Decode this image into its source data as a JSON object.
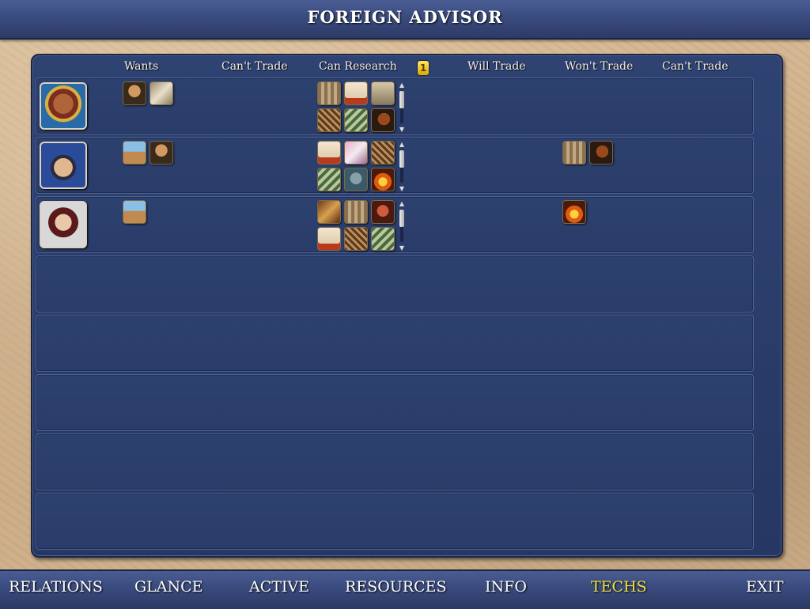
{
  "window": {
    "title": "FOREIGN ADVISOR"
  },
  "columns": {
    "wants": "Wants",
    "cant_trade_left": "Can't Trade",
    "can_research": "Can Research",
    "gold_icon": "gold-icon",
    "will_trade": "Will Trade",
    "wont_trade": "Won't Trade",
    "cant_trade_right": "Can't Trade"
  },
  "civs": [
    {
      "leader_icon": "aztec-leader-portrait",
      "wants": [
        "philosophy-tech-icon",
        "writing-tech-icon"
      ],
      "can_research": [
        "code-of-laws-tech-icon",
        "literacy-tech-icon",
        "mythology-tech-icon",
        "mathematics-tech-icon",
        "currency-tech-icon",
        "horseback-riding-tech-icon"
      ],
      "wont_trade": []
    },
    {
      "leader_icon": "mongol-leader-portrait",
      "wants": [
        "masonry-tech-icon",
        "philosophy-tech-icon"
      ],
      "can_research": [
        "literacy-tech-icon",
        "philosophy-tech-icon",
        "mathematics-tech-icon",
        "currency-tech-icon",
        "monotheism-tech-icon",
        "bronze-working-tech-icon"
      ],
      "wont_trade": [
        "code-of-laws-tech-icon",
        "horseback-riding-tech-icon"
      ]
    },
    {
      "leader_icon": "european-leader-portrait",
      "wants": [
        "masonry-tech-icon"
      ],
      "can_research": [
        "writing-tech-icon",
        "code-of-laws-tech-icon",
        "warrior-code-tech-icon",
        "literacy-tech-icon",
        "mathematics-tech-icon",
        "currency-tech-icon"
      ],
      "wont_trade": [
        "bronze-working-tech-icon"
      ]
    }
  ],
  "colors": {
    "panel": "#2a3d6b",
    "active_tab": "#f2e23a"
  },
  "nav": {
    "relations": "RELATIONS",
    "glance": "GLANCE",
    "active": "ACTIVE",
    "resources": "RESOURCES",
    "info": "INFO",
    "techs": "TECHS",
    "exit": "EXIT",
    "selected": "TECHS"
  }
}
